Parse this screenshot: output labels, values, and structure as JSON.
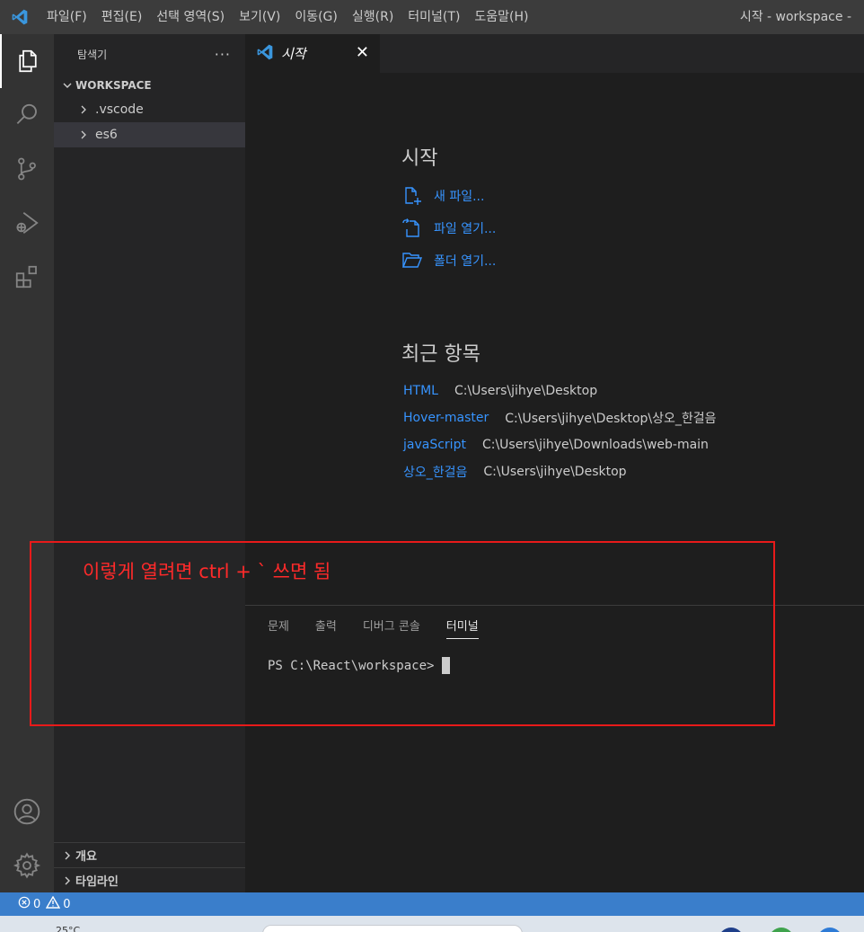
{
  "titlebar": {
    "menu": [
      "파일(F)",
      "편집(E)",
      "선택 영역(S)",
      "보기(V)",
      "이동(G)",
      "실행(R)",
      "터미널(T)",
      "도움말(H)"
    ],
    "window_title": "시작 - workspace -"
  },
  "activitybar": {
    "items": [
      "explorer-icon",
      "search-icon",
      "source-control-icon",
      "run-debug-icon",
      "extensions-icon"
    ],
    "bottom": [
      "account-icon",
      "settings-gear-icon"
    ]
  },
  "sidebar": {
    "title": "탐색기",
    "more": "···",
    "section": "WORKSPACE",
    "tree": [
      {
        "label": ".vscode"
      },
      {
        "label": "es6"
      }
    ],
    "outline": "개요",
    "timeline": "타임라인"
  },
  "tab": {
    "title": "시작",
    "close": "✕"
  },
  "welcome": {
    "start_heading": "시작",
    "actions": [
      {
        "label": "새 파일...",
        "icon": "new-file-icon"
      },
      {
        "label": "파일 열기...",
        "icon": "open-file-icon"
      },
      {
        "label": "폴더 열기...",
        "icon": "open-folder-icon"
      }
    ],
    "recent_heading": "최근 항목",
    "recent": [
      {
        "name": "HTML",
        "path": "C:\\Users\\jihye\\Desktop"
      },
      {
        "name": "Hover-master",
        "path": "C:\\Users\\jihye\\Desktop\\상오_한걸음"
      },
      {
        "name": "javaScript",
        "path": "C:\\Users\\jihye\\Downloads\\web-main"
      },
      {
        "name": "상오_한걸음",
        "path": "C:\\Users\\jihye\\Desktop"
      }
    ]
  },
  "panel": {
    "tabs": [
      "문제",
      "출력",
      "디버그 콘솔",
      "터미널"
    ],
    "active_tab": "터미널",
    "prompt": "PS C:\\React\\workspace>"
  },
  "annotation": {
    "text": "이렇게 열려면 ctrl + ` 쓰면 됨",
    "color": "#e81a1a"
  },
  "statusbar": {
    "errors": "0",
    "warnings": "0"
  },
  "taskbar": {
    "weather": "25°C"
  },
  "colors": {
    "accent": "#3a7ecb",
    "link": "#3794ff"
  }
}
